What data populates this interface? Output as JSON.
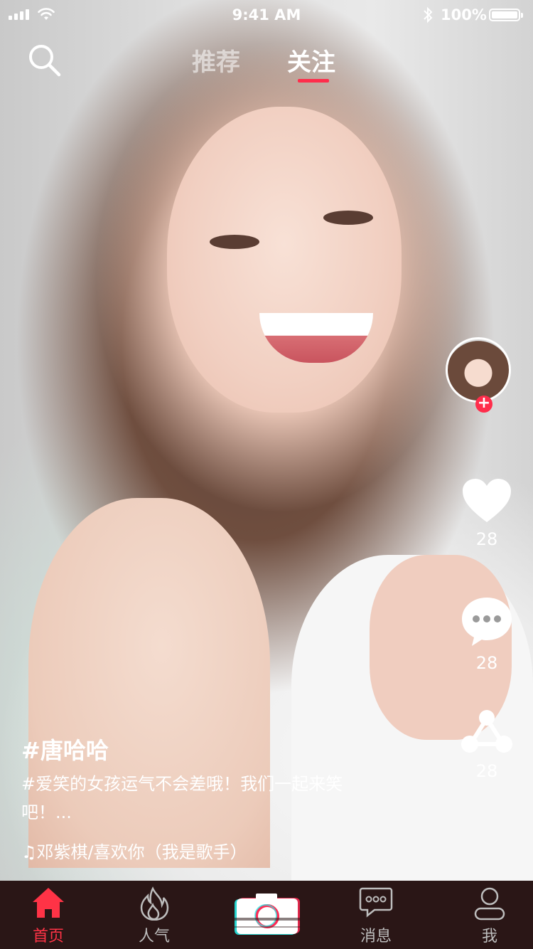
{
  "status_bar": {
    "time": "9:41 AM",
    "battery": "100%"
  },
  "header": {
    "tabs": [
      {
        "label": "推荐",
        "active": false
      },
      {
        "label": "关注",
        "active": true
      }
    ]
  },
  "actions": {
    "likes": "28",
    "comments": "28",
    "shares": "28",
    "follow_symbol": "+"
  },
  "post": {
    "username": "#唐哈哈",
    "caption": "#爱笑的女孩运气不会差哦！我们一起来笑吧！...",
    "music": "♫邓紫棋/喜欢你（我是歌手）"
  },
  "bottom_nav": {
    "items": [
      {
        "label": "首页",
        "icon": "home-icon",
        "active": true
      },
      {
        "label": "人气",
        "icon": "flame-icon",
        "active": false
      },
      {
        "label": "",
        "icon": "camera-icon",
        "active": false
      },
      {
        "label": "消息",
        "icon": "message-icon",
        "active": false
      },
      {
        "label": "我",
        "icon": "user-icon",
        "active": false
      }
    ]
  },
  "colors": {
    "accent": "#ff2d4b",
    "nav_bg": "#2a1616"
  }
}
